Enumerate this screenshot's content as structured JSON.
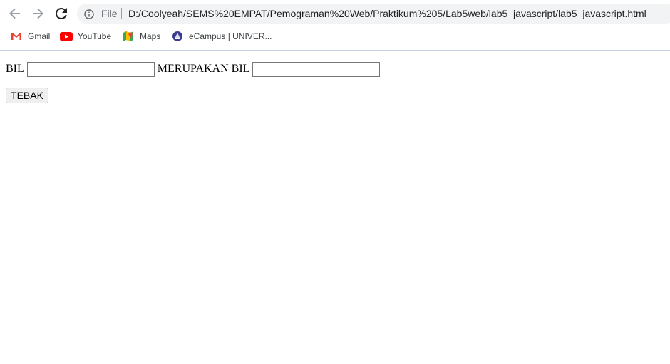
{
  "browser": {
    "address_prefix": "File",
    "url": "D:/Coolyeah/SEMS%20EMPAT/Pemograman%20Web/Praktikum%205/Lab5web/lab5_javascript/lab5_javascript.html",
    "icons": {
      "back": "back-arrow-icon",
      "forward": "forward-arrow-icon",
      "reload": "reload-icon",
      "info": "info-icon"
    }
  },
  "bookmarks": [
    {
      "label": "Gmail",
      "icon": "gmail-icon"
    },
    {
      "label": "YouTube",
      "icon": "youtube-icon"
    },
    {
      "label": "Maps",
      "icon": "maps-icon"
    },
    {
      "label": "eCampus | UNIVER...",
      "icon": "ecampus-icon"
    }
  ],
  "page": {
    "label_bil": "BIL",
    "input1_value": "",
    "label_merupakan": "MERUPAKAN BIL",
    "input2_value": "",
    "button_label": "TEBAK"
  },
  "colors": {
    "omnibox_bg": "#f1f3f4",
    "youtube_red": "#ff0000",
    "gmail_red": "#ea4335"
  }
}
